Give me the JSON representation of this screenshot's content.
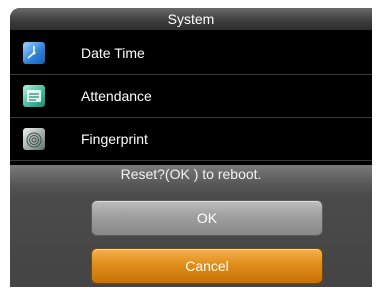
{
  "titlebar": {
    "title": "System"
  },
  "menu": {
    "items": [
      {
        "label": "Date Time",
        "icon": "clock-icon"
      },
      {
        "label": "Attendance",
        "icon": "attendance-icon"
      },
      {
        "label": "Fingerprint",
        "icon": "fingerprint-icon"
      }
    ]
  },
  "dialog": {
    "message": "Reset?(OK ) to reboot.",
    "ok_label": "OK",
    "cancel_label": "Cancel"
  },
  "colors": {
    "cancel_accent": "#e08e1b",
    "ok_gray": "#a0a0a0",
    "background": "#000000"
  }
}
